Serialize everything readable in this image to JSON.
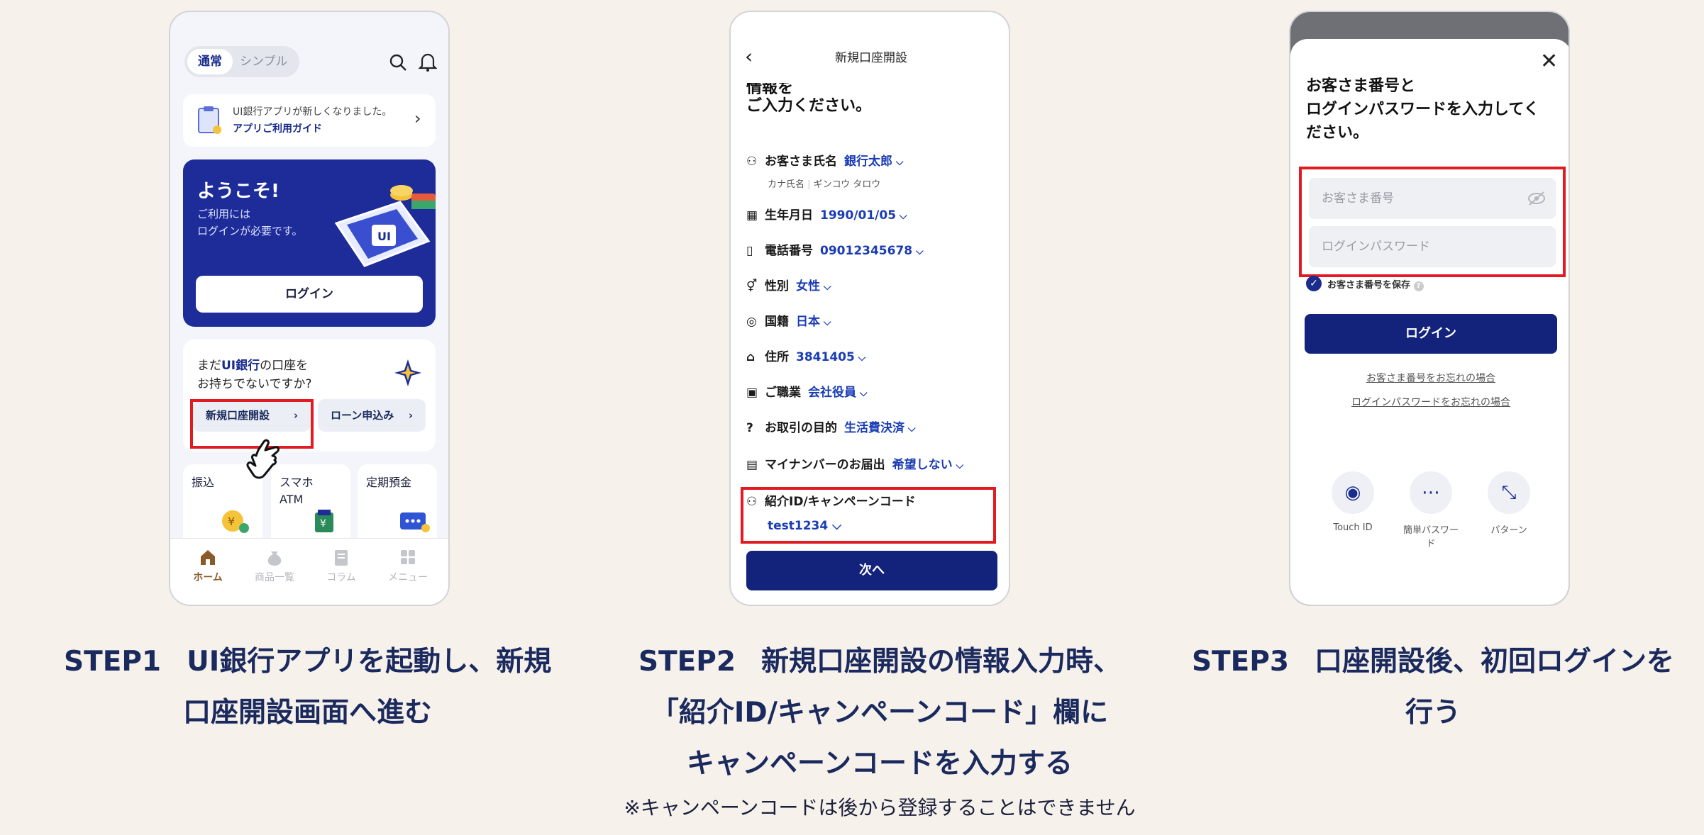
{
  "colors": {
    "navy": "#13237c",
    "highlight": "#e21b23",
    "link_value": "#1a3cb4"
  },
  "phone1": {
    "seg_on": "通常",
    "seg_off": "シンプル",
    "notice_text": "UI銀行アプリが新しくなりました。",
    "notice_link": "アプリご利用ガイド",
    "welcome_title": "ようこそ!",
    "welcome_line1": "ご利用には",
    "welcome_line2": "ログインが必要です。",
    "login_button": "ログイン",
    "account_q_prefix": "まだ",
    "account_q_bank": "UI銀行",
    "account_q_rest": "の口座を",
    "account_q_line2": "お持ちでないですか?",
    "open_account_button": "新規口座開設",
    "loan_button": "ローン申込み",
    "tile_transfer": "振込",
    "tile_atm": "スマホ\nATM",
    "tile_deposit": "定期預金",
    "tabs": [
      "ホーム",
      "商品一覧",
      "コラム",
      "メニュー"
    ]
  },
  "phone2": {
    "title": "新規口座開設",
    "heading_partial": "情報を",
    "heading": "ご入力ください。",
    "name_label": "お客さま氏名",
    "name_value": "銀行太郎",
    "kana_label": "カナ氏名",
    "kana_value": "ギンコウ タロウ",
    "birth_label": "生年月日",
    "birth_value": "1990/01/05",
    "phone_label": "電話番号",
    "phone_value": "09012345678",
    "gender_label": "性別",
    "gender_value": "女性",
    "nation_label": "国籍",
    "nation_value": "日本",
    "address_label": "住所",
    "address_value": "3841405",
    "job_label": "ご職業",
    "job_value": "会社役員",
    "purpose_label": "お取引の目的",
    "purpose_value": "生活費決済",
    "mynumber_label": "マイナンバーのお届出",
    "mynumber_value": "希望しない",
    "referral_label": "紹介ID/キャンペーンコード",
    "referral_value": "test1234",
    "next_button": "次へ"
  },
  "phone3": {
    "heading": "お客さま番号と\nログインパスワードを入力してく\nださい。",
    "customer_placeholder": "お客さま番号",
    "password_placeholder": "ログインパスワード",
    "save_label": "お客さま番号を保存",
    "login_button": "ログイン",
    "forgot_number": "お客さま番号をお忘れの場合",
    "forgot_password": "ログインパスワードをお忘れの場合",
    "bio_touch": "Touch ID",
    "bio_simple": "簡単パスワード",
    "bio_pattern": "パターン"
  },
  "captions": {
    "step1_label": "STEP1",
    "step1_text": "UI銀行アプリを起動し、新規",
    "step1_text2": "口座開設画面へ進む",
    "step2_label": "STEP2",
    "step2_text": "新規口座開設の情報入力時、",
    "step2_text2": "「紹介ID/キャンペーンコード」欄に",
    "step2_text3": "キャンペーンコードを入力する",
    "step2_note": "※キャンペーンコードは後から登録することはできません",
    "step3_label": "STEP3",
    "step3_text": "口座開設後、初回ログインを",
    "step3_text2": "行う"
  }
}
